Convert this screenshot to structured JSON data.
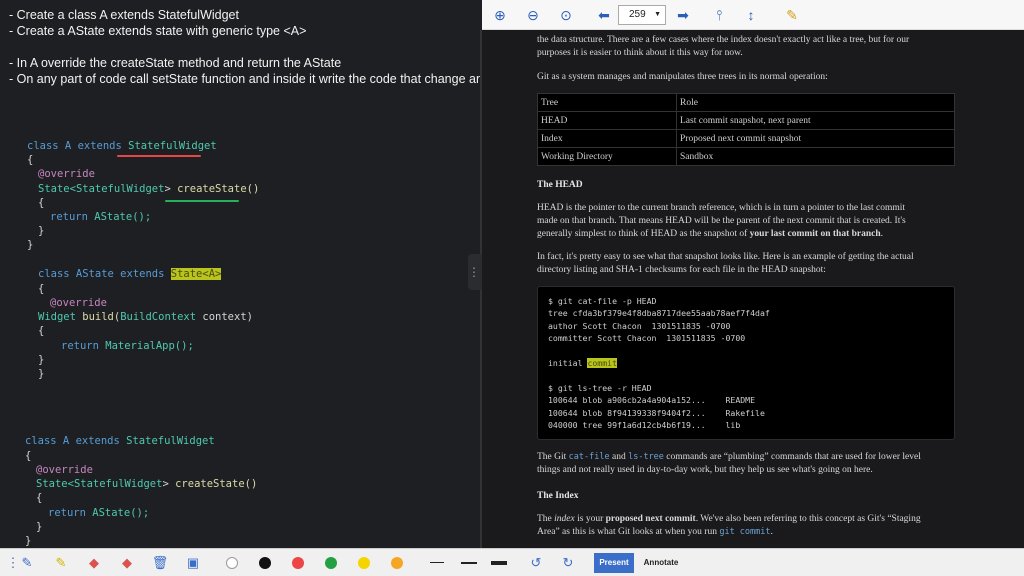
{
  "notes": [
    "- Create a class A extends StatefulWidget",
    "- Create a AState extends state with generic type <A>",
    "- In A override the createState method and return the AState",
    "- On any part of code call setState function and inside it write the code that change anyt"
  ],
  "code1": {
    "l1a": "class A extends ",
    "l1b": "StatefulWidget",
    "l2": "{",
    "l3": "@override",
    "l4a": "State<",
    "l4b": "StatefulWidget",
    "l4c": "> ",
    "l4d": "createState()",
    "l5": "{",
    "l6a": "return ",
    "l6b": "AState();",
    "l7": "}",
    "l8": "}"
  },
  "code2": {
    "l1a": "class AState extends ",
    "l1b": "State<A>",
    "l2": "{",
    "l3": "@override",
    "l4a": "Widget ",
    "l4b": "build(",
    "l4c": "BuildContext",
    "l4d": " context)",
    "l5": "{",
    "l6a": "return ",
    "l6b": "MaterialApp();",
    "l7": "}",
    "l8": "}"
  },
  "code3": {
    "l1a": "class A extends ",
    "l1b": "StatefulWidget",
    "l2": "{",
    "l3": "@override",
    "l4a": "State<",
    "l4b": "StatefulWidget",
    "l4c": "> ",
    "l4d": "createState()",
    "l5": "{",
    "l6a": "return ",
    "l6b": "AState();",
    "l7": "}",
    "l8": "}"
  },
  "toolbar": {
    "page": "259"
  },
  "doc": {
    "top1": "the data structure. There are a few cases where the index doesn't exactly act like a tree, but for our",
    "top2": "purposes it is easier to think about it this way for now.",
    "intro": "Git as a system manages and manipulates three trees in its normal operation:",
    "table_head": [
      "Tree",
      "Role"
    ],
    "table_rows": [
      [
        "HEAD",
        "Last commit snapshot, next parent"
      ],
      [
        "Index",
        "Proposed next commit snapshot"
      ],
      [
        "Working Directory",
        "Sandbox"
      ]
    ],
    "h_head": "The HEAD",
    "p_head1": "HEAD is the pointer to the current branch reference, which is in turn a pointer to the last commit",
    "p_head2": "made on that branch. That means HEAD will be the parent of the next commit that is created. It's",
    "p_head3": "generally simplest to think of HEAD as the snapshot of ",
    "p_head3b": "your last commit on that branch",
    "p_head3c": ".",
    "p_fact1": "In fact, it's pretty easy to see what that snapshot looks like. Here is an example of getting the actual",
    "p_fact2": "directory listing and SHA-1 checksums for each file in the HEAD snapshot:",
    "code_lines": [
      "$ git cat-file -p HEAD",
      "tree cfda3bf379e4f8dba8717dee55aab78aef7f4daf",
      "author Scott Chacon  1301511835 -0700",
      "committer Scott Chacon  1301511835 -0700",
      "",
      "initial ",
      "",
      "$ git ls-tree -r HEAD",
      "100644 blob a906cb2a4a904a152...    README",
      "100644 blob 8f94139338f9404f2...    Rakefile",
      "040000 tree 99f1a6d12cb4b6f19...    lib"
    ],
    "code_hl": "commit",
    "p_plumb1a": "The Git ",
    "p_plumb1b": "cat-file",
    "p_plumb1c": " and ",
    "p_plumb1d": "ls-tree",
    "p_plumb1e": " commands are “plumbing” commands that are used for lower level",
    "p_plumb2": "things and not really used in day-to-day work, but they help us see what's going on here.",
    "h_index": "The Index",
    "p_idx1a": "The ",
    "p_idx1b": "index",
    "p_idx1c": " is your ",
    "p_idx1d": "proposed next commit",
    "p_idx1e": ". We've also been referring to this concept as Git's “Staging",
    "p_idx2a": "Area” as this is what Git looks at when you run ",
    "p_idx2b": "git commit",
    "p_idx2c": "."
  },
  "bottom": {
    "present": "Present",
    "annotate": "Annotate"
  },
  "colors": {
    "white": "#ffffff",
    "black": "#111111",
    "red": "#ee4444",
    "green": "#22a043",
    "yellow": "#f5d400",
    "orange": "#f5a623"
  }
}
